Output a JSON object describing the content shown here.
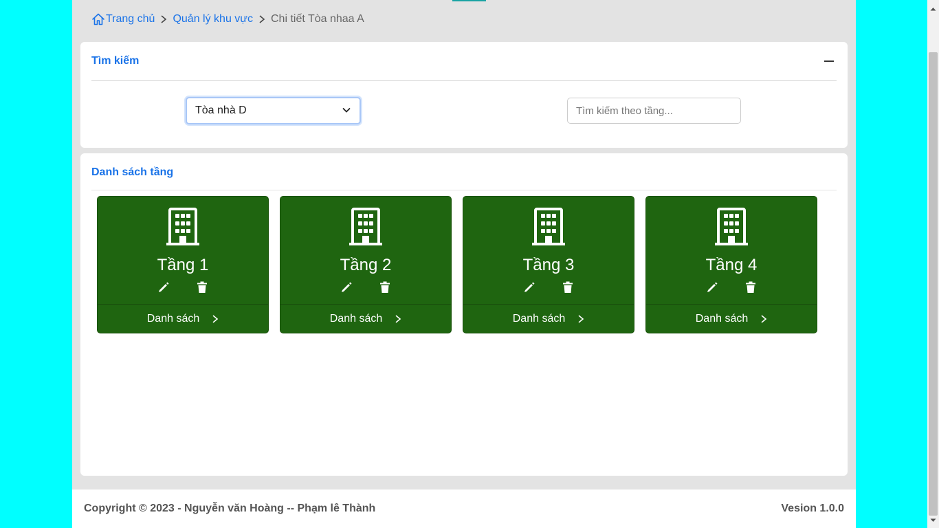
{
  "breadcrumb": {
    "home": "Trang chủ",
    "area": "Quản lý khu vực",
    "current": "Chi tiết Tòa nhaa A"
  },
  "search": {
    "title": "Tìm kiếm",
    "building_selected": "Tòa nhà D",
    "floor_placeholder": "Tìm kiếm theo tầng..."
  },
  "floor_list": {
    "title": "Danh sách tầng",
    "floors": [
      {
        "name": "Tầng 1",
        "link_label": "Danh sách"
      },
      {
        "name": "Tầng 2",
        "link_label": "Danh sách"
      },
      {
        "name": "Tầng 3",
        "link_label": "Danh sách"
      },
      {
        "name": "Tầng 4",
        "link_label": "Danh sách"
      }
    ]
  },
  "footer": {
    "copyright": "Copyright © 2023 - Nguyễn văn Hoàng -- Phạm lê Thành",
    "version": "Vesion 1.0.0"
  },
  "colors": {
    "background": "#00ffff",
    "accent": "#1a73e8",
    "floor_card": "#1f6510"
  }
}
